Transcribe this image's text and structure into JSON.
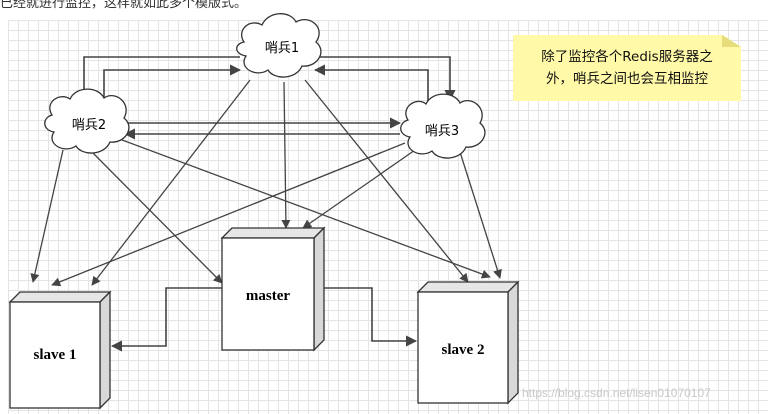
{
  "header_text": "已经就进行监控，这样就如此多个模版式。",
  "sentinels": {
    "s1": "哨兵1",
    "s2": "哨兵2",
    "s3": "哨兵3"
  },
  "servers": {
    "master": "master",
    "slave1": "slave 1",
    "slave2": "slave 2"
  },
  "note": {
    "line1": "除了监控各个Redis服务器之",
    "line2": "外，哨兵之间也会互相监控"
  },
  "watermark": "https://blog.csdn.net/lisen01070107",
  "colors": {
    "note_background": "#fff9a8",
    "line": "#444444",
    "box_side": "#d8d8d8"
  }
}
